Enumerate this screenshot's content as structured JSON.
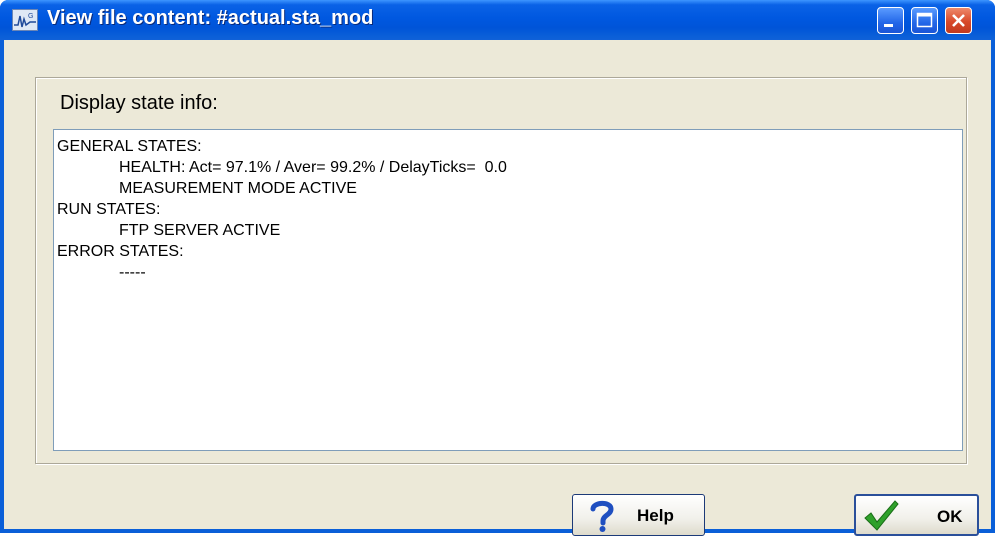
{
  "window": {
    "title": "View file content: #actual.sta_mod"
  },
  "title_buttons": [
    "minimize-button",
    "maximize-button",
    "close-button"
  ],
  "group": {
    "label": "Display state info:"
  },
  "content": {
    "lines": [
      {
        "text": "GENERAL STATES:",
        "indent": 0
      },
      {
        "text": "HEALTH: Act= 97.1% / Aver= 99.2% / DelayTicks=  0.0",
        "indent": 1
      },
      {
        "text": "MEASUREMENT MODE ACTIVE",
        "indent": 1
      },
      {
        "text": "RUN STATES:",
        "indent": 0
      },
      {
        "text": "FTP SERVER ACTIVE",
        "indent": 1
      },
      {
        "text": "ERROR STATES:",
        "indent": 0
      },
      {
        "text": "-----",
        "indent": 1
      }
    ]
  },
  "buttons": {
    "help_label": "Help",
    "help_icon": "question-mark-icon",
    "ok_label": "OK",
    "ok_icon": "checkmark-icon"
  },
  "colors": {
    "titlebar": "#0058e0",
    "dialog_bg": "#ece9d8",
    "close_button": "#d8492a",
    "check_green": "#2fa12b",
    "help_blue": "#1f4fc0"
  }
}
